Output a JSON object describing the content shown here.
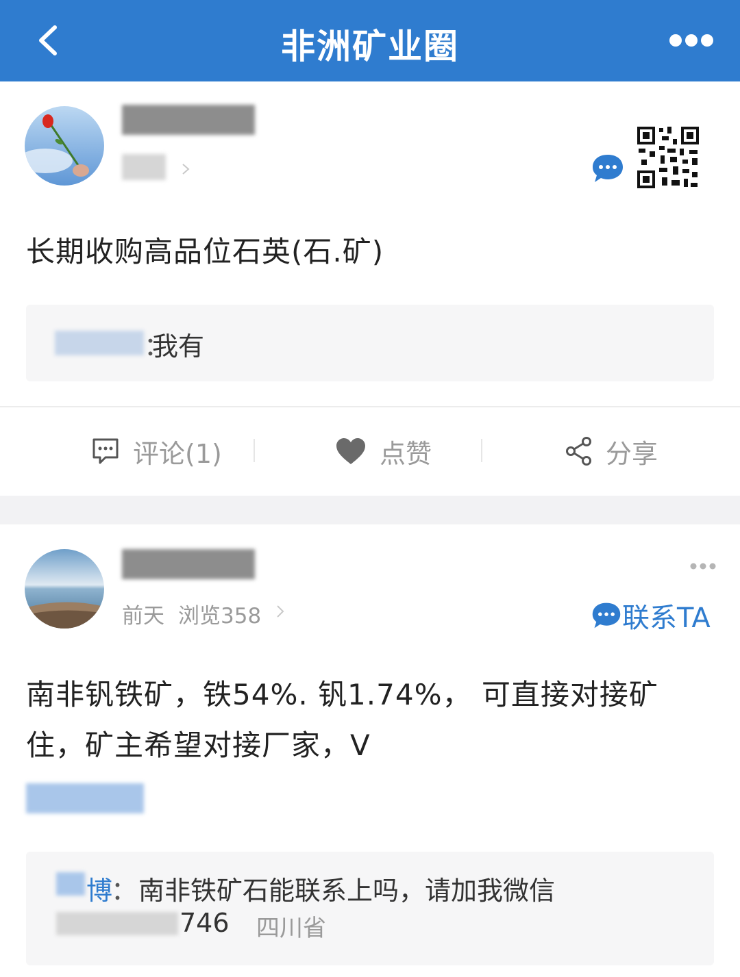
{
  "header": {
    "title": "非洲矿业圈"
  },
  "post1": {
    "content": "长期收购高品位石英(石.矿)",
    "comment": {
      "separator": "：",
      "text": "我有"
    },
    "actions": {
      "comment_label": "评论(1)",
      "like_label": "点赞",
      "share_label": "分享"
    }
  },
  "post2": {
    "time": "前天",
    "views": "浏览358",
    "contact_label": "联系TA",
    "content_line1": "南非钒铁矿，铁54%. 钒1.74%， 可直接对接矿",
    "content_line2": "住，矿主希望对接厂家，V",
    "comment": {
      "author_visible": "博",
      "separator": "：",
      "text": "南非铁矿石能联系上吗，请加我微信",
      "suffix": "746",
      "location": "四川省"
    }
  },
  "colors": {
    "brand": "#2f7ccf",
    "muted": "#9a9a9a"
  }
}
